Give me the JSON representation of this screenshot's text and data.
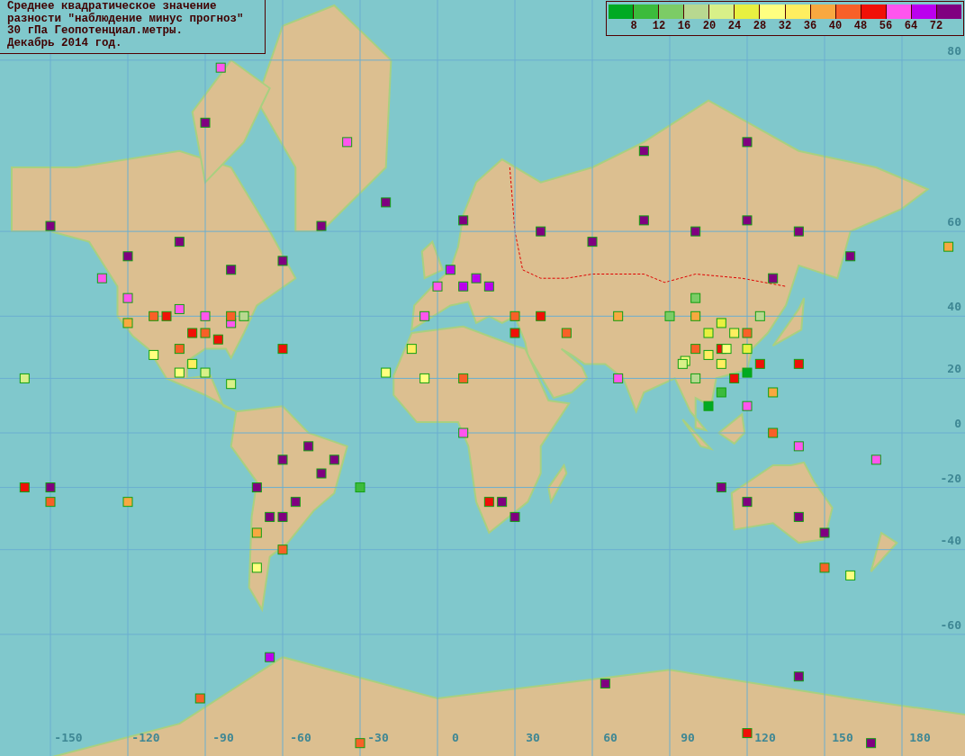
{
  "title_box": {
    "lines": [
      "Среднее квадратическое значение",
      "разности \"наблюдение минус прогноз\"",
      "30 гПа Геопотенциал.метры.",
      "Декабрь 2014 год."
    ]
  },
  "legend": {
    "swatches": [
      {
        "color": "#00aa22"
      },
      {
        "color": "#3cbb3c"
      },
      {
        "color": "#7ccc66"
      },
      {
        "color": "#b8d890"
      },
      {
        "color": "#d8f088"
      },
      {
        "color": "#e8f040"
      },
      {
        "color": "#ffff80"
      },
      {
        "color": "#ffee60"
      },
      {
        "color": "#f8a840"
      },
      {
        "color": "#f86028"
      },
      {
        "color": "#f01008"
      },
      {
        "color": "#ff55ee"
      },
      {
        "color": "#bb00ee"
      },
      {
        "color": "#800080"
      }
    ],
    "labels": [
      "8",
      "12",
      "16",
      "20",
      "24",
      "28",
      "32",
      "36",
      "40",
      "48",
      "56",
      "64",
      "72"
    ]
  },
  "map": {
    "longitude_labels": [
      "-150",
      "-120",
      "-90",
      "-60",
      "-30",
      "0",
      "30",
      "60",
      "90",
      "120",
      "150",
      "180"
    ],
    "latitude_labels": [
      "80",
      "60",
      "40",
      "20",
      "0",
      "-20",
      "-40",
      "-60"
    ],
    "stations": [
      {
        "color": "#800080"
      },
      {
        "color": "#800080"
      },
      {
        "color": "#800080"
      },
      {
        "color": "#800080"
      },
      {
        "color": "#800080"
      },
      {
        "color": "#800080"
      },
      {
        "color": "#800080"
      },
      {
        "color": "#800080"
      },
      {
        "color": "#800080"
      },
      {
        "color": "#800080"
      },
      {
        "color": "#800080"
      },
      {
        "color": "#800080"
      },
      {
        "color": "#800080"
      },
      {
        "color": "#800080"
      },
      {
        "color": "#800080"
      },
      {
        "color": "#800080"
      },
      {
        "color": "#800080"
      },
      {
        "color": "#800080"
      },
      {
        "color": "#800080"
      },
      {
        "color": "#800080"
      },
      {
        "color": "#800080"
      },
      {
        "color": "#800080"
      },
      {
        "color": "#800080"
      },
      {
        "color": "#800080"
      },
      {
        "color": "#800080"
      },
      {
        "color": "#800080"
      },
      {
        "color": "#800080"
      },
      {
        "color": "#800080"
      },
      {
        "color": "#800080"
      },
      {
        "color": "#800080"
      },
      {
        "color": "#800080"
      },
      {
        "color": "#800080"
      },
      {
        "color": "#800080"
      },
      {
        "color": "#800080"
      },
      {
        "color": "#800080"
      },
      {
        "color": "#800080"
      },
      {
        "color": "#800080"
      },
      {
        "color": "#bb00ee"
      },
      {
        "color": "#bb00ee"
      },
      {
        "color": "#bb00ee"
      },
      {
        "color": "#bb00ee"
      },
      {
        "color": "#bb00ee"
      },
      {
        "color": "#ff55ee"
      },
      {
        "color": "#ff55ee"
      },
      {
        "color": "#ff55ee"
      },
      {
        "color": "#ff55ee"
      },
      {
        "color": "#ff55ee"
      },
      {
        "color": "#ff55ee"
      },
      {
        "color": "#ff55ee"
      },
      {
        "color": "#ff55ee"
      },
      {
        "color": "#ff55ee"
      },
      {
        "color": "#ff55ee"
      },
      {
        "color": "#ff55ee"
      },
      {
        "color": "#ff55ee"
      },
      {
        "color": "#ff55ee"
      },
      {
        "color": "#ff55ee"
      },
      {
        "color": "#f01008"
      },
      {
        "color": "#f01008"
      },
      {
        "color": "#f01008"
      },
      {
        "color": "#f01008"
      },
      {
        "color": "#f01008"
      },
      {
        "color": "#f01008"
      },
      {
        "color": "#f01008"
      },
      {
        "color": "#f01008"
      },
      {
        "color": "#f01008"
      },
      {
        "color": "#f01008"
      },
      {
        "color": "#f01008"
      },
      {
        "color": "#f01008"
      },
      {
        "color": "#f01008"
      },
      {
        "color": "#f86028"
      },
      {
        "color": "#f86028"
      },
      {
        "color": "#f86028"
      },
      {
        "color": "#f86028"
      },
      {
        "color": "#f86028"
      },
      {
        "color": "#f86028"
      },
      {
        "color": "#f86028"
      },
      {
        "color": "#f86028"
      },
      {
        "color": "#f86028"
      },
      {
        "color": "#f86028"
      },
      {
        "color": "#f86028"
      },
      {
        "color": "#f86028"
      },
      {
        "color": "#f86028"
      },
      {
        "color": "#f86028"
      },
      {
        "color": "#f86028"
      },
      {
        "color": "#f8a840"
      },
      {
        "color": "#f8a840"
      },
      {
        "color": "#f8a840"
      },
      {
        "color": "#f8a840"
      },
      {
        "color": "#f8a840"
      },
      {
        "color": "#f8a840"
      },
      {
        "color": "#f8a840"
      },
      {
        "color": "#ffee60"
      },
      {
        "color": "#ffee60"
      },
      {
        "color": "#ffee60"
      },
      {
        "color": "#ffee60"
      },
      {
        "color": "#ffee60"
      },
      {
        "color": "#ffff80"
      },
      {
        "color": "#ffff80"
      },
      {
        "color": "#ffff80"
      },
      {
        "color": "#ffff80"
      },
      {
        "color": "#ffff80"
      },
      {
        "color": "#ffff80"
      },
      {
        "color": "#ffff80"
      },
      {
        "color": "#ffff80"
      },
      {
        "color": "#e8f040"
      },
      {
        "color": "#e8f040"
      },
      {
        "color": "#e8f040"
      },
      {
        "color": "#d8f088"
      },
      {
        "color": "#d8f088"
      },
      {
        "color": "#d8f088"
      },
      {
        "color": "#d8f088"
      },
      {
        "color": "#b8d890"
      },
      {
        "color": "#b8d890"
      },
      {
        "color": "#b8d890"
      },
      {
        "color": "#7ccc66"
      },
      {
        "color": "#7ccc66"
      },
      {
        "color": "#3cbb3c"
      },
      {
        "color": "#3cbb3c"
      },
      {
        "color": "#00aa22"
      },
      {
        "color": "#00aa22"
      }
    ]
  }
}
